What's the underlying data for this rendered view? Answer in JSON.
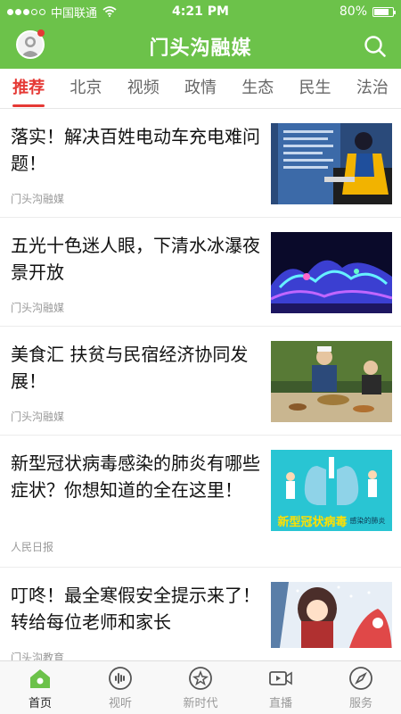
{
  "status_bar": {
    "carrier": "中国联通",
    "time": "4:21 PM",
    "battery": "80%",
    "battery_level": 0.8,
    "signal_bars": 3
  },
  "header": {
    "title": "门头沟融媒",
    "left_icon": "avatar-icon",
    "right_icon": "search-icon",
    "brand_color": "#6cc24a"
  },
  "tabs": [
    {
      "label": "推荐",
      "active": true
    },
    {
      "label": "北京"
    },
    {
      "label": "视频"
    },
    {
      "label": "政情"
    },
    {
      "label": "生态"
    },
    {
      "label": "民生"
    },
    {
      "label": "法治"
    }
  ],
  "articles": [
    {
      "headline": "落实！解决百姓电动车充电难问题！",
      "source": "门头沟融媒"
    },
    {
      "headline": "五光十色迷人眼，下清水冰瀑夜景开放",
      "source": "门头沟融媒"
    },
    {
      "headline": "美食汇 扶贫与民宿经济协同发展！",
      "source": "门头沟融媒"
    },
    {
      "headline": "新型冠状病毒感染的肺炎有哪些症状？你想知道的全在这里！",
      "source": "人民日报",
      "thumb_caption_main": "新型冠状病毒",
      "thumb_caption_sub": "感染的肺炎"
    },
    {
      "headline": "叮咚！最全寒假安全提示来了！转给每位老师和家长",
      "source": "门头沟教育"
    }
  ],
  "bottom_nav": [
    {
      "label": "首页",
      "icon": "home-icon",
      "active": true
    },
    {
      "label": "视听",
      "icon": "audio-wave-icon"
    },
    {
      "label": "新时代",
      "icon": "star-badge-icon"
    },
    {
      "label": "直播",
      "icon": "video-icon"
    },
    {
      "label": "服务",
      "icon": "compass-icon"
    }
  ],
  "colors": {
    "accent_red": "#e53935",
    "brand_green": "#6cc24a"
  }
}
